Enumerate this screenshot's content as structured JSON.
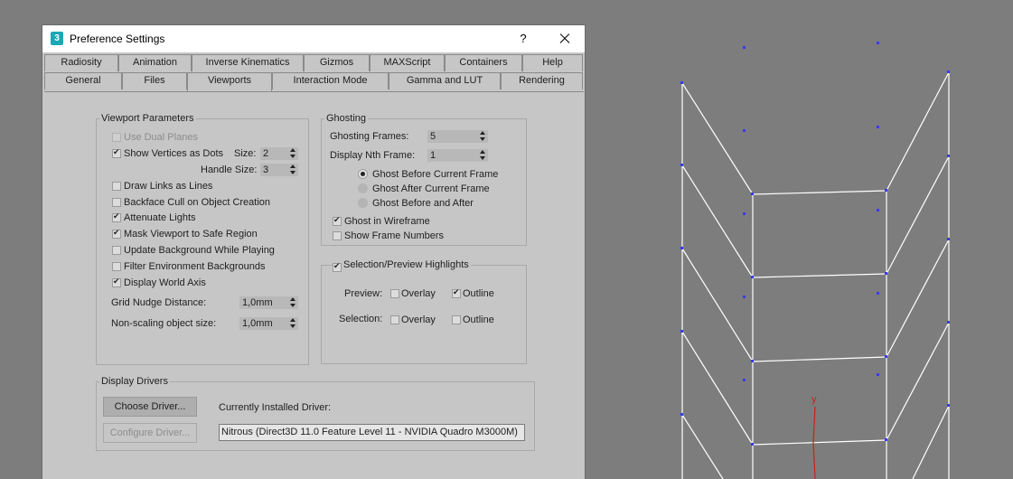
{
  "dialog": {
    "title": "Preference Settings",
    "app_icon": "3",
    "help_label": "?"
  },
  "tabs_row1": [
    "Radiosity",
    "Animation",
    "Inverse Kinematics",
    "Gizmos",
    "MAXScript",
    "Containers",
    "Help"
  ],
  "tabs_row2": [
    "General",
    "Files",
    "Viewports",
    "Interaction Mode",
    "Gamma and LUT",
    "Rendering"
  ],
  "active_tab": "Viewports",
  "viewport_parameters": {
    "title": "Viewport Parameters",
    "use_dual_planes": "Use Dual Planes",
    "show_vertices": "Show Vertices as Dots",
    "size_label": "Size:",
    "size_value": "2",
    "handle_size_label": "Handle Size:",
    "handle_size_value": "3",
    "draw_links": "Draw Links as Lines",
    "backface_cull": "Backface Cull on Object Creation",
    "attenuate_lights": "Attenuate Lights",
    "mask_viewport": "Mask Viewport to Safe Region",
    "update_background": "Update Background While Playing",
    "filter_env": "Filter Environment Backgrounds",
    "display_world_axis": "Display World Axis",
    "grid_nudge_label": "Grid Nudge Distance:",
    "grid_nudge_value": "1,0mm",
    "non_scaling_label": "Non-scaling object size:",
    "non_scaling_value": "1,0mm"
  },
  "ghosting": {
    "title": "Ghosting",
    "frames_label": "Ghosting Frames:",
    "frames_value": "5",
    "nth_label": "Display Nth Frame:",
    "nth_value": "1",
    "before": "Ghost Before Current Frame",
    "after": "Ghost After Current Frame",
    "before_after": "Ghost Before and After",
    "wireframe": "Ghost in Wireframe",
    "frame_numbers": "Show Frame Numbers"
  },
  "highlights": {
    "title": "Selection/Preview Highlights",
    "preview_label": "Preview:",
    "selection_label": "Selection:",
    "overlay": "Overlay",
    "outline": "Outline"
  },
  "display_drivers": {
    "title": "Display Drivers",
    "choose_driver": "Choose Driver...",
    "configure_driver": "Configure Driver...",
    "installed_label": "Currently Installed Driver:",
    "installed_value": "Nitrous (Direct3D 11.0 Feature Level 11 - NVIDIA Quadro M3000M)"
  },
  "viewport": {
    "axis_label": "y",
    "wire_color": "#ffffff",
    "vertex_color": "#3a3af0",
    "axis_color": "#cc1f1f"
  }
}
